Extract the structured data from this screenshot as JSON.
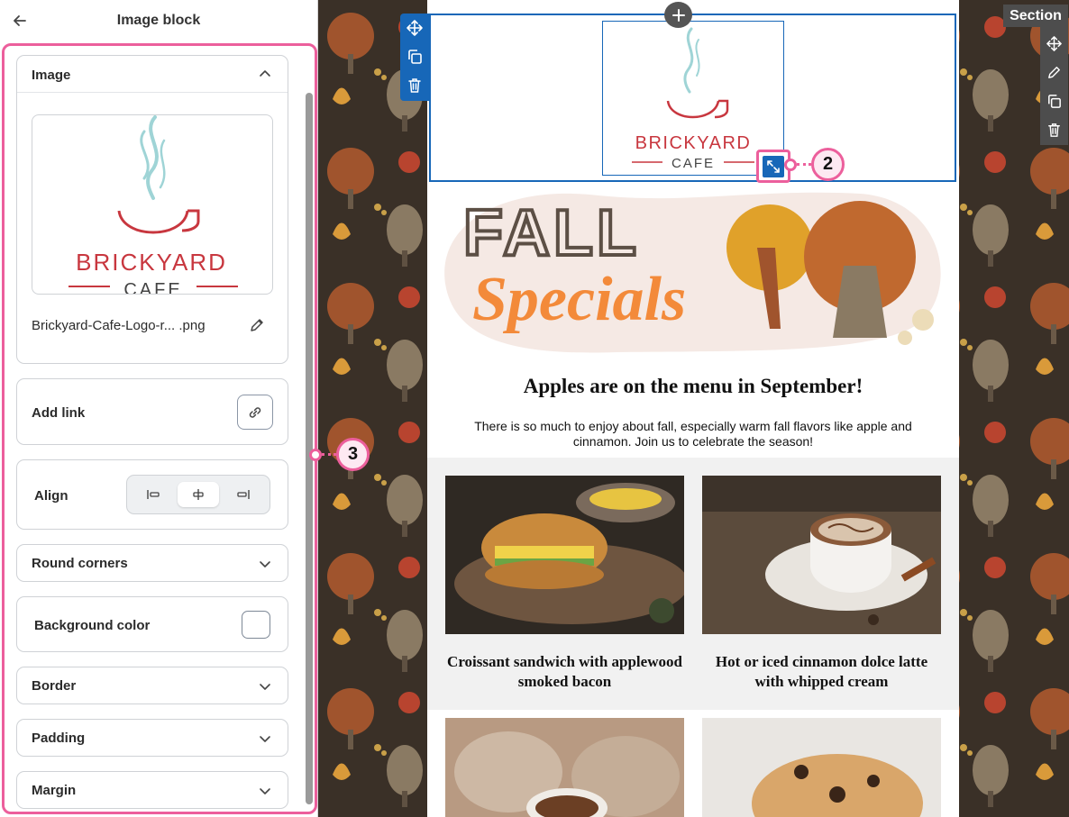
{
  "panel": {
    "title": "Image block",
    "image_section": {
      "title": "Image",
      "file_name": "Brickyard-Cafe-Logo-r... .png"
    },
    "add_link": {
      "label": "Add link"
    },
    "align": {
      "label": "Align",
      "options": [
        "left",
        "center",
        "right"
      ],
      "selected": "center"
    },
    "round_corners": {
      "label": "Round corners"
    },
    "background_color": {
      "label": "Background color",
      "value": "#ffffff"
    },
    "border": {
      "label": "Border"
    },
    "padding": {
      "label": "Padding"
    },
    "margin": {
      "label": "Margin"
    }
  },
  "logo": {
    "line1": "BRICKYARD",
    "line2": "CAFE"
  },
  "banner": {
    "line1": "FALL",
    "line2": "Specials"
  },
  "canvas": {
    "section_label": "Section",
    "headline": "Apples are on the menu in September!",
    "intro": "There is so much to enjoy about fall, especially warm fall flavors like apple and cinnamon. Join us to celebrate the season!",
    "products": [
      {
        "caption": "Croissant sandwich with applewood smoked bacon"
      },
      {
        "caption": "Hot or iced cinnamon dolce latte with whipped cream"
      }
    ]
  },
  "callouts": {
    "resize": "2",
    "panel": "3"
  },
  "colors": {
    "accent": "#1767b8",
    "callout": "#ec5f9c",
    "brand_red": "#c8373f",
    "steam": "#9fd4d6"
  }
}
